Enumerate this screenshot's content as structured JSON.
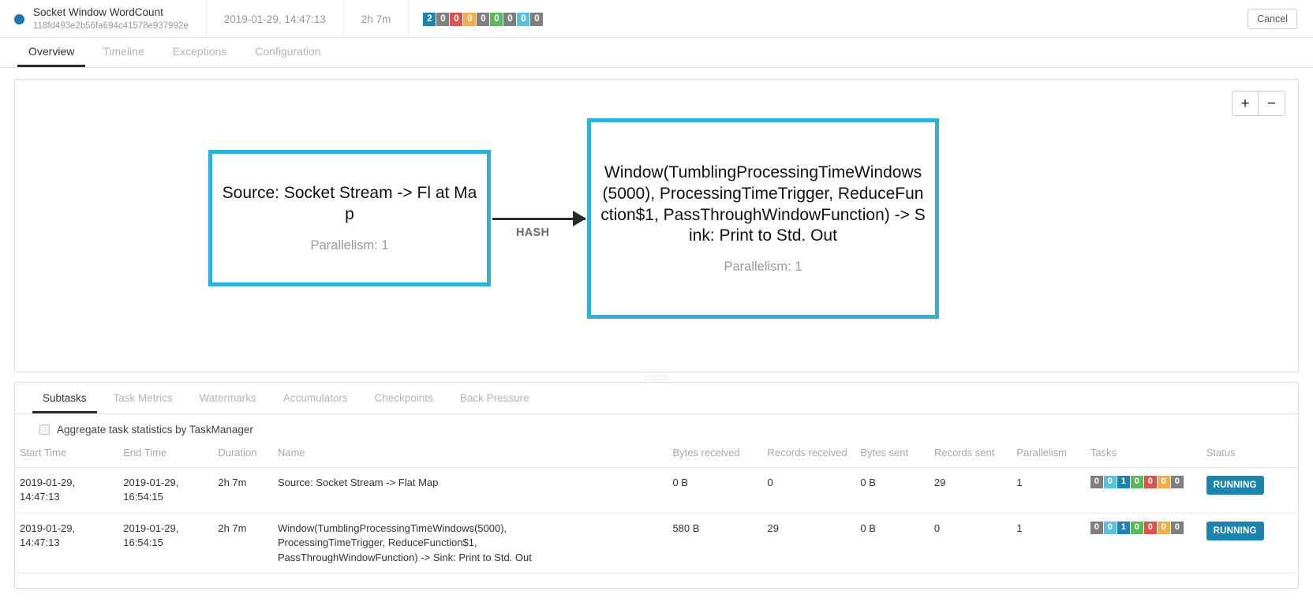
{
  "header": {
    "job_name": "Socket Window WordCount",
    "job_id": "118fd493e2b56fa694c41578e937992e",
    "start_time": "2019-01-29, 14:47:13",
    "duration": "2h 7m",
    "cancel_label": "Cancel",
    "status_dot_color": "#1b76a9",
    "badges": [
      {
        "value": "2",
        "color": "#1b84ad"
      },
      {
        "value": "0",
        "color": "#7f7f7f"
      },
      {
        "value": "0",
        "color": "#d9534f"
      },
      {
        "value": "0",
        "color": "#f0ad4e"
      },
      {
        "value": "0",
        "color": "#7f7f7f"
      },
      {
        "value": "0",
        "color": "#5cb85c"
      },
      {
        "value": "0",
        "color": "#7f7f7f"
      },
      {
        "value": "0",
        "color": "#5bc0de"
      },
      {
        "value": "0",
        "color": "#7f7f7f"
      }
    ]
  },
  "nav_tabs": [
    {
      "label": "Overview",
      "active": true
    },
    {
      "label": "Timeline",
      "active": false
    },
    {
      "label": "Exceptions",
      "active": false
    },
    {
      "label": "Configuration",
      "active": false
    }
  ],
  "graph": {
    "zoom_in_label": "+",
    "zoom_out_label": "−",
    "edge_label": "HASH",
    "node_border_color": "#31b0d5",
    "nodes": [
      {
        "id": "node-source",
        "label": "Source: Socket Stream -> Fl at Map",
        "parallelism": "Parallelism: 1"
      },
      {
        "id": "node-window",
        "label": "Window(TumblingProcessingTimeWindows(5000), ProcessingTimeTrigger, ReduceFunction$1, PassThroughWindowFunction) -> Sink: Print to Std. Out",
        "parallelism": "Parallelism: 1"
      }
    ]
  },
  "resizer": {
    "grip": "::::::::"
  },
  "detail": {
    "sub_tabs": [
      {
        "label": "Subtasks",
        "active": true
      },
      {
        "label": "Task Metrics",
        "active": false
      },
      {
        "label": "Watermarks",
        "active": false
      },
      {
        "label": "Accumulators",
        "active": false
      },
      {
        "label": "Checkpoints",
        "active": false
      },
      {
        "label": "Back Pressure",
        "active": false
      }
    ],
    "aggregate_label": "Aggregate task statistics by TaskManager",
    "aggregate_checked": false,
    "columns": [
      "Start Time",
      "End Time",
      "Duration",
      "Name",
      "Bytes received",
      "Records received",
      "Bytes sent",
      "Records sent",
      "Parallelism",
      "Tasks",
      "Status"
    ],
    "rows": [
      {
        "start_time": "2019-01-29, 14:47:13",
        "end_time": "2019-01-29, 16:54:15",
        "duration": "2h 7m",
        "name_lines": [
          "Source: Socket Stream -> Flat Map"
        ],
        "bytes_received": "0 B",
        "records_received": "0",
        "bytes_sent": "0 B",
        "records_sent": "29",
        "parallelism": "1",
        "tasks": [
          {
            "value": "0",
            "color": "#7f7f7f"
          },
          {
            "value": "0",
            "color": "#5bc0de"
          },
          {
            "value": "1",
            "color": "#1b84ad"
          },
          {
            "value": "0",
            "color": "#5cb85c"
          },
          {
            "value": "0",
            "color": "#d9534f"
          },
          {
            "value": "0",
            "color": "#f0ad4e"
          },
          {
            "value": "0",
            "color": "#7f7f7f"
          }
        ],
        "status": "RUNNING"
      },
      {
        "start_time": "2019-01-29, 14:47:13",
        "end_time": "2019-01-29, 16:54:15",
        "duration": "2h 7m",
        "name_lines": [
          "Window(TumblingProcessingTimeWindows(5000),",
          "ProcessingTimeTrigger, ReduceFunction$1,",
          "PassThroughWindowFunction) -> Sink: Print to Std. Out"
        ],
        "bytes_received": "580 B",
        "records_received": "29",
        "bytes_sent": "0 B",
        "records_sent": "0",
        "parallelism": "1",
        "tasks": [
          {
            "value": "0",
            "color": "#7f7f7f"
          },
          {
            "value": "0",
            "color": "#5bc0de"
          },
          {
            "value": "1",
            "color": "#1b84ad"
          },
          {
            "value": "0",
            "color": "#5cb85c"
          },
          {
            "value": "0",
            "color": "#d9534f"
          },
          {
            "value": "0",
            "color": "#f0ad4e"
          },
          {
            "value": "0",
            "color": "#7f7f7f"
          }
        ],
        "status": "RUNNING"
      }
    ]
  }
}
